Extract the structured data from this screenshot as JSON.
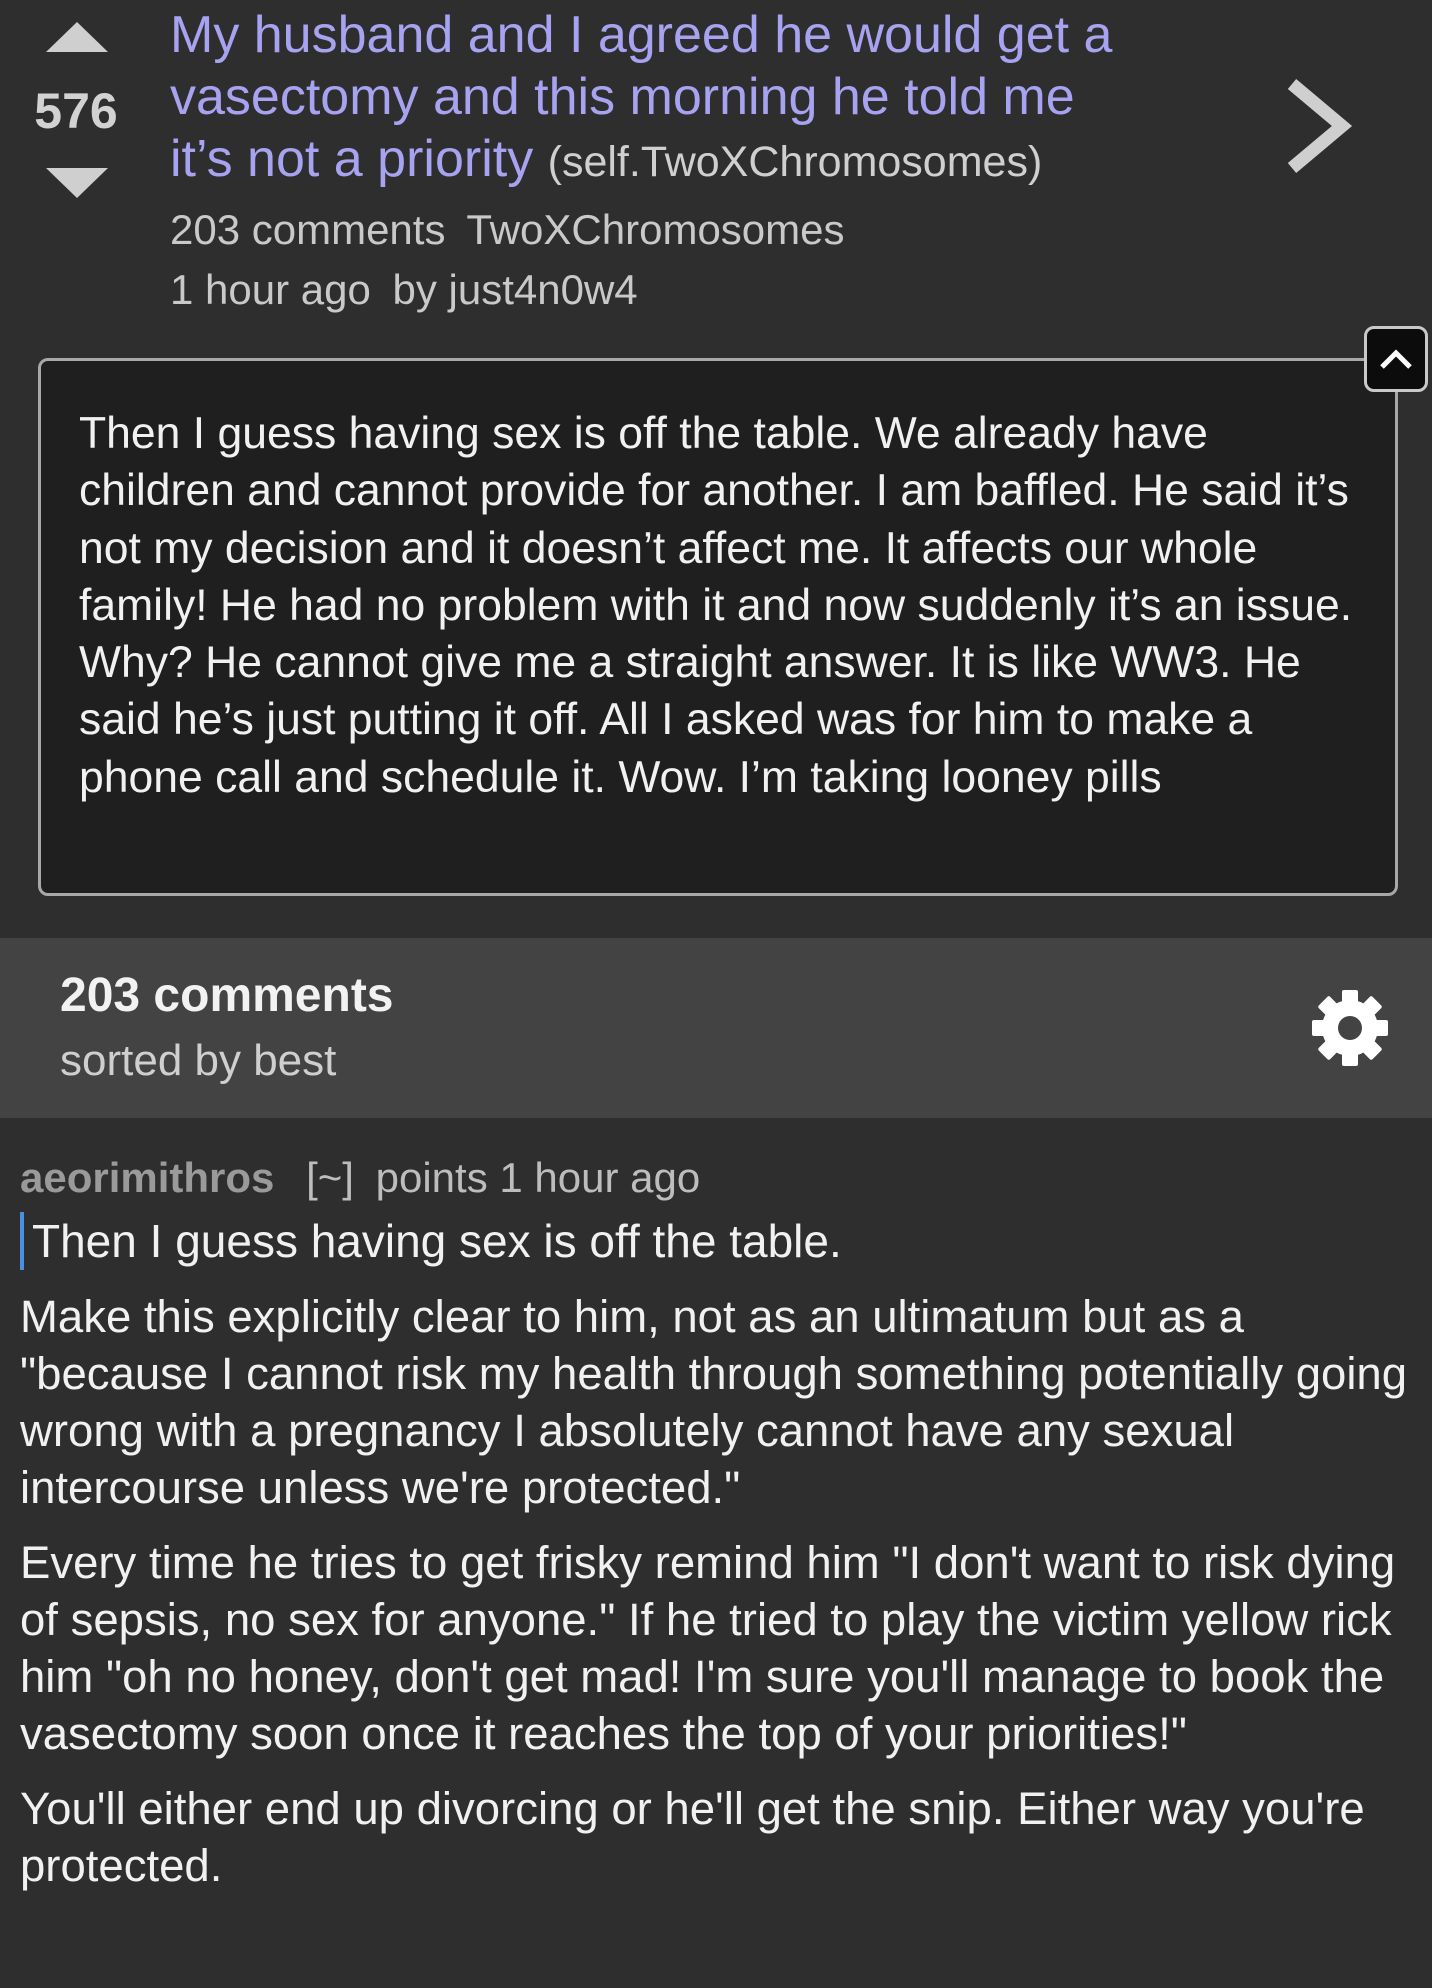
{
  "post": {
    "score": "576",
    "title": "My husband and I agreed he would get a vasectomy and this morning he told me it’s not a priority",
    "domain": "(self.TwoXChromosomes)",
    "comments_link": "203 comments",
    "subreddit": "TwoXChromosomes",
    "time": "1 hour ago",
    "author": "by just4n0w4",
    "selftext": "Then I guess having sex is off the table. We already have children and cannot provide for another. I am baffled. He said it’s not my decision and it doesn’t affect me. It affects our whole family! He had no problem with it and now suddenly it’s an issue. Why? He cannot give me a straight answer. It is like WW3. He said he’s just putting it off. All I asked was for him to make a phone call and schedule it. Wow. I’m taking looney pills"
  },
  "comments_header": {
    "count": "203 comments",
    "sort": "sorted by best"
  },
  "comment": {
    "author": "aeorimithros",
    "toggle": "[~]",
    "points": "points",
    "time": "1 hour ago",
    "quote": "Then I guess having sex is off the table.",
    "paragraphs": [
      "Make this explicitly clear to him, not as an ultimatum but as a \"because I cannot risk my health through something potentially going wrong with a pregnancy I absolutely cannot have any sexual intercourse unless we're protected.\"",
      "Every time he tries to get frisky remind him \"I don't want to risk dying of sepsis, no sex for anyone.\" If he tried to play the victim yellow rick him \"oh no honey, don't get mad! I'm sure you'll manage to book the vasectomy soon once it reaches the top of your priorities!\"",
      "You'll either end up divorcing or he'll get the snip. Either way you're protected."
    ]
  },
  "icons": {
    "upvote": "upvote-arrow-icon",
    "downvote": "downvote-arrow-icon",
    "next": "chevron-right-icon",
    "collapse": "chevron-up-icon",
    "settings": "gear-icon"
  }
}
